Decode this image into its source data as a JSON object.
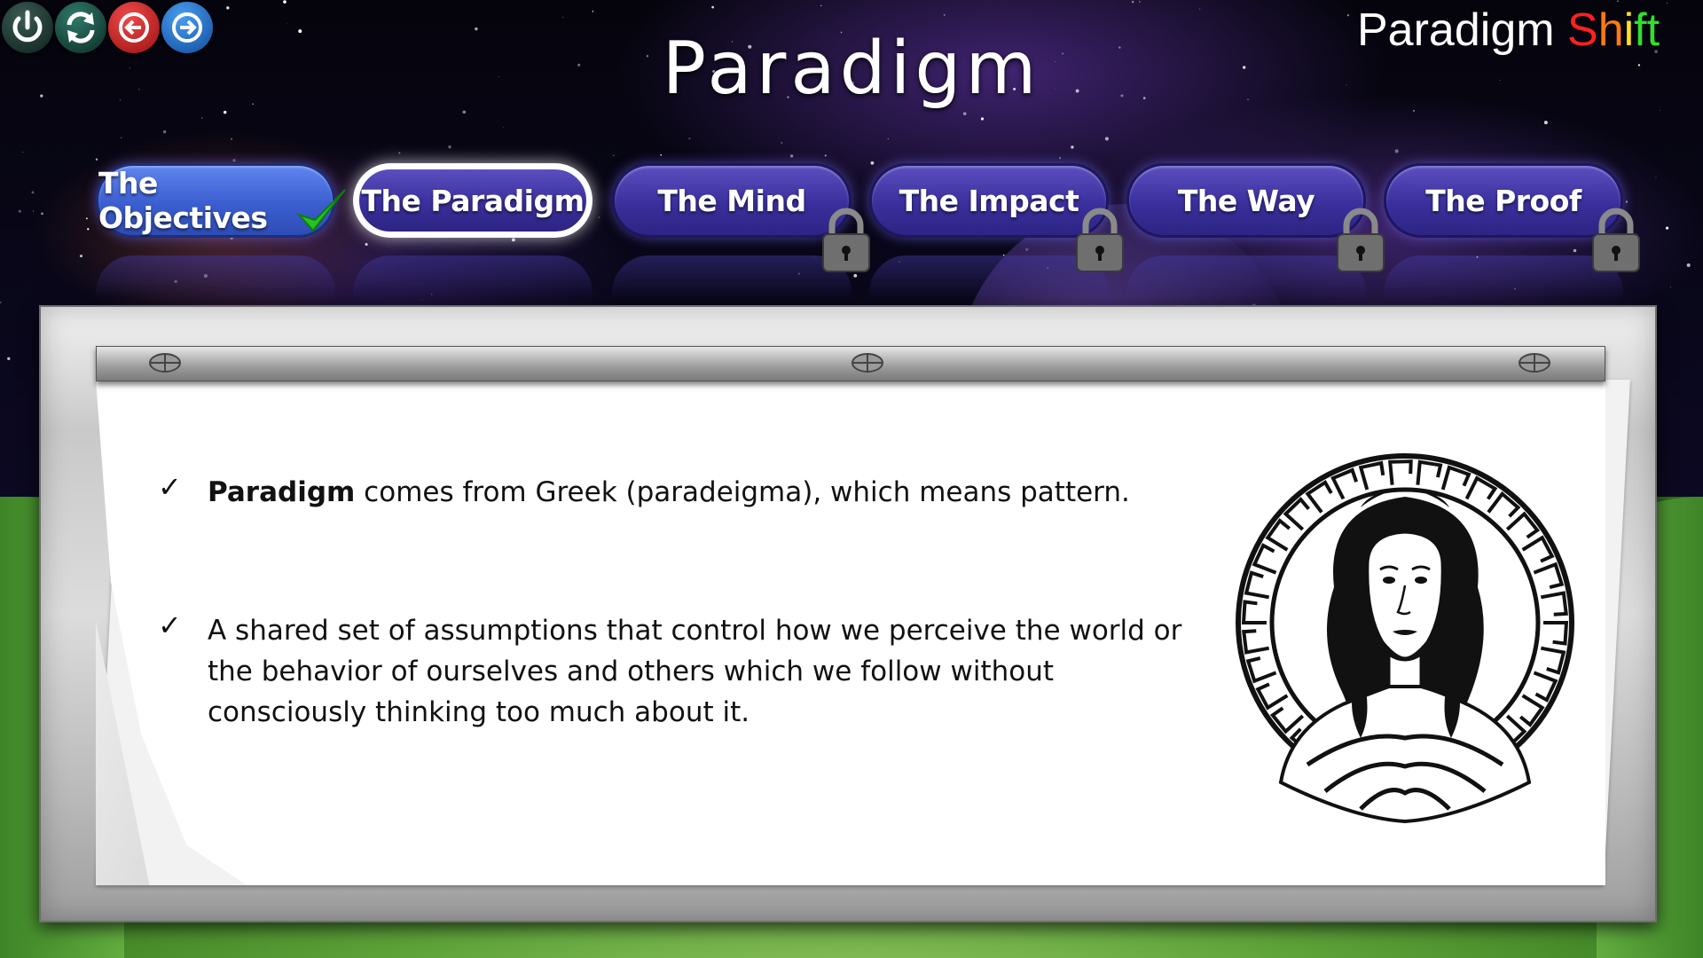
{
  "controls": {
    "power_icon": "power-icon",
    "refresh_icon": "refresh-icon",
    "back_icon": "arrow-left-icon",
    "next_icon": "arrow-right-icon"
  },
  "header": {
    "title": "Paradigm",
    "brand_part1": "Paradigm ",
    "brand_s": "S",
    "brand_h": "h",
    "brand_i": "i",
    "brand_ft": "ft"
  },
  "tabs": [
    {
      "label": "The Objectives",
      "state": "completed"
    },
    {
      "label": "The Paradigm",
      "state": "active"
    },
    {
      "label": "The Mind",
      "state": "locked"
    },
    {
      "label": "The Impact",
      "state": "locked"
    },
    {
      "label": "The Way",
      "state": "locked"
    },
    {
      "label": "The Proof",
      "state": "locked"
    }
  ],
  "content": {
    "bullet_symbol": "✓",
    "point1_bold": "Paradigm",
    "point1_rest": " comes from Greek (paradeigma), which means pattern.",
    "point2": "A shared set of assumptions that control how we perceive the world or the behavior of ourselves and others which we follow without consciously thinking too much about it."
  },
  "colors": {
    "tab_blue": "#3a2f9c",
    "tab_completed": "#3b5ed0",
    "check_green": "#22c322"
  }
}
